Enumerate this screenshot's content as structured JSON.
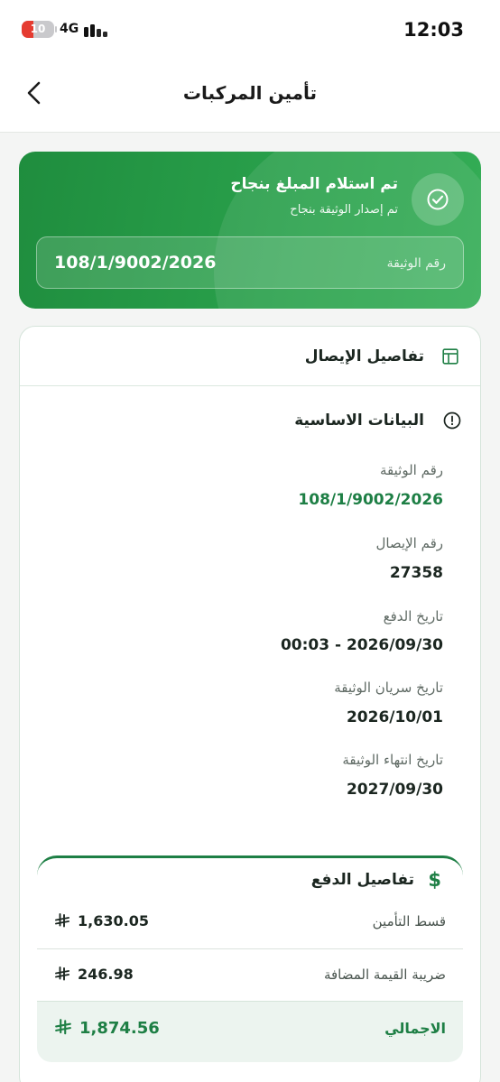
{
  "status_bar": {
    "battery": "10",
    "network": "4G",
    "time": "12:03"
  },
  "header": {
    "title": "تأمين المركبات",
    "back_icon": "chevron-left-icon"
  },
  "banner": {
    "title": "تم استلام المبلغ بنجاح",
    "subtitle": "تم إصدار الوثيقة بنجاح",
    "policy_label": "رقم الوثيقة",
    "policy_number": "108/1/9002/2026",
    "icon": "check-circle-icon"
  },
  "receipt": {
    "title": "تفاصيل الإيصال",
    "section_title": "البيانات الاساسية",
    "fields": [
      {
        "label": "رقم الوثيقة",
        "value": "108/1/9002/2026"
      },
      {
        "label": "رقم الإيصال",
        "value": "27358"
      },
      {
        "label": "تاريخ الدفع",
        "value": "00:03 - 2026/09/30"
      },
      {
        "label": "تاريخ سريان الوثيقة",
        "value": "2026/10/01"
      },
      {
        "label": "تاريخ انتهاء الوثيقة",
        "value": "2027/09/30"
      }
    ]
  },
  "payment": {
    "title": "تفاصيل الدفع",
    "rows": [
      {
        "label": "قسط التأمين",
        "amount": "1,630.05"
      },
      {
        "label": "ضريبة القيمة المضافة",
        "amount": "246.98"
      }
    ],
    "total": {
      "label": "الاجمالي",
      "amount": "1,874.56"
    }
  },
  "colors": {
    "brand_green": "#1e7f45",
    "banner_green": "#29a04b",
    "battery_low": "#e53b30"
  }
}
